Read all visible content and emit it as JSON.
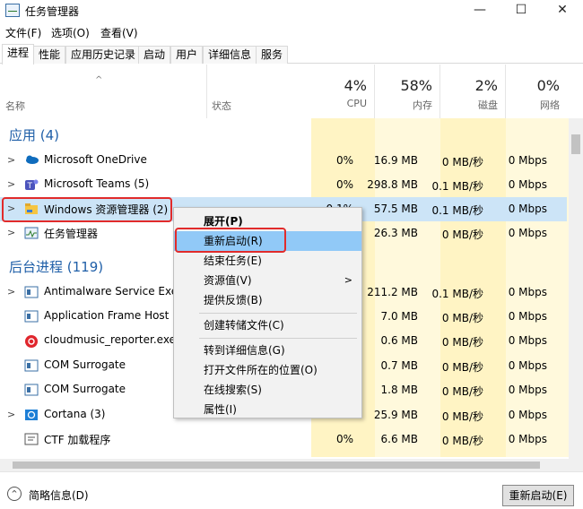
{
  "window": {
    "title": "任务管理器",
    "controls": [
      "—",
      "☐",
      "✕"
    ]
  },
  "menu": [
    "文件(F)",
    "选项(O)",
    "查看(V)"
  ],
  "tabs": [
    "进程",
    "性能",
    "应用历史记录",
    "启动",
    "用户",
    "详细信息",
    "服务"
  ],
  "columns": {
    "name": "名称",
    "status": "状态",
    "cpu": {
      "pct": "4%",
      "label": "CPU"
    },
    "memory": {
      "pct": "58%",
      "label": "内存"
    },
    "disk": {
      "pct": "2%",
      "label": "磁盘"
    },
    "network": {
      "pct": "0%",
      "label": "网络"
    }
  },
  "groups": {
    "apps": "应用 (4)",
    "background": "后台进程 (119)"
  },
  "rows": [
    {
      "name": "Microsoft OneDrive",
      "cpu": "0%",
      "mem": "16.9 MB",
      "disk": "0 MB/秒",
      "net": "0 Mbps"
    },
    {
      "name": "Microsoft Teams (5)",
      "cpu": "0%",
      "mem": "298.8 MB",
      "disk": "0.1 MB/秒",
      "net": "0 Mbps"
    },
    {
      "name": "Windows 资源管理器 (2)",
      "cpu": "0.1%",
      "mem": "57.5 MB",
      "disk": "0.1 MB/秒",
      "net": "0 Mbps"
    },
    {
      "name": "任务管理器",
      "cpu": "",
      "mem": "26.3 MB",
      "disk": "0 MB/秒",
      "net": "0 Mbps"
    },
    {
      "name": "Antimalware Service Executable",
      "cpu": "%",
      "mem": "211.2 MB",
      "disk": "0.1 MB/秒",
      "net": "0 Mbps"
    },
    {
      "name": "Application Frame Host",
      "cpu": "%",
      "mem": "7.0 MB",
      "disk": "0 MB/秒",
      "net": "0 Mbps"
    },
    {
      "name": "cloudmusic_reporter.exe",
      "cpu": "%",
      "mem": "0.6 MB",
      "disk": "0 MB/秒",
      "net": "0 Mbps"
    },
    {
      "name": "COM Surrogate",
      "cpu": "%",
      "mem": "0.7 MB",
      "disk": "0 MB/秒",
      "net": "0 Mbps"
    },
    {
      "name": "COM Surrogate",
      "cpu": "%",
      "mem": "1.8 MB",
      "disk": "0 MB/秒",
      "net": "0 Mbps"
    },
    {
      "name": "Cortana (3)",
      "cpu": "%",
      "mem": "25.9 MB",
      "disk": "0 MB/秒",
      "net": "0 Mbps"
    },
    {
      "name": "CTF 加载程序",
      "cpu": "0%",
      "mem": "6.6 MB",
      "disk": "0 MB/秒",
      "net": "0 Mbps"
    }
  ],
  "context_menu": [
    "展开(P)",
    "重新启动(R)",
    "结束任务(E)",
    "资源值(V)",
    "提供反馈(B)",
    "创建转储文件(C)",
    "转到详细信息(G)",
    "打开文件所在的位置(O)",
    "在线搜索(S)",
    "属性(I)"
  ],
  "footer": {
    "fewer_details": "简略信息(D)",
    "restart_button": "重新启动(E)"
  },
  "colors": {
    "accent": "#1f5fa8",
    "highlight": "#91c9f7",
    "callout": "#e12b2b"
  }
}
